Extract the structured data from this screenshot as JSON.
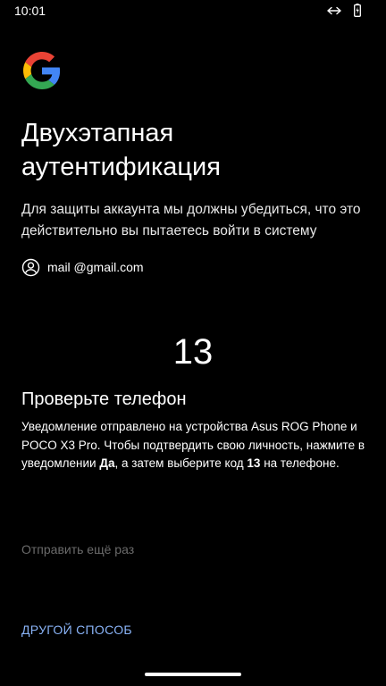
{
  "status_bar": {
    "time": "10:01"
  },
  "header": {
    "logo_icon": "google-g-icon",
    "title": "Двухэтапная аутентификация",
    "description": "Для защиты аккаунта мы должны убедиться, что это действительно вы пытаетесь войти в систему"
  },
  "account": {
    "icon": "account-circle-icon",
    "email": "mail @gmail.com"
  },
  "verification": {
    "code": "13",
    "heading": "Проверьте телефон",
    "text_part1": "Уведомление отправлено на устройства Asus ROG Phone и POCO X3 Pro. Чтобы подтвердить свою личность, нажмите в уведомлении ",
    "bold_yes": "Да",
    "text_part2": ", а затем выберите код ",
    "bold_code": "13",
    "text_part3": " на телефоне."
  },
  "actions": {
    "resend_label": "Отправить ещё раз",
    "other_method_label": "ДРУГОЙ СПОСОБ"
  },
  "colors": {
    "background": "#000000",
    "link_blue": "#8ab4f8",
    "disabled_gray": "#6b6b6b"
  }
}
